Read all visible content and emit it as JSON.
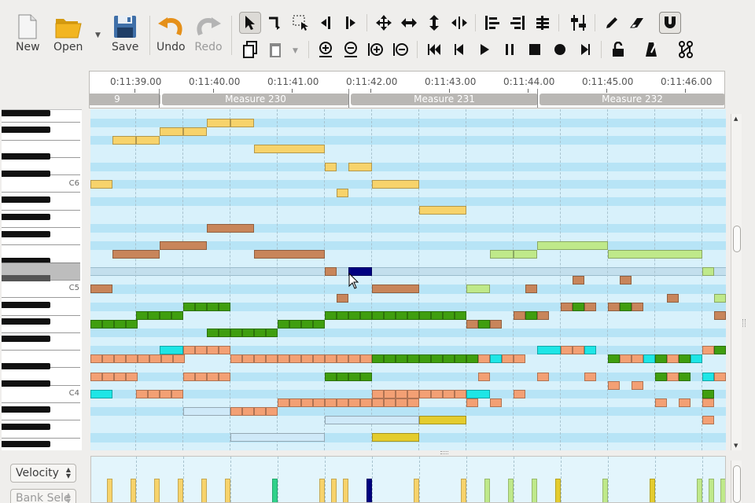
{
  "toolbar": {
    "new_label": "New",
    "open_label": "Open",
    "save_label": "Save",
    "undo_label": "Undo",
    "redo_label": "Redo"
  },
  "ruler": {
    "times": [
      "0:11:39.00",
      "0:11:40.00",
      "0:11:41.00",
      "0:11:42.00",
      "0:11:43.00",
      "0:11:44.00",
      "0:11:45.00",
      "0:11:46.00"
    ],
    "measures": [
      "9",
      "Measure 230",
      "Measure 231",
      "Measure 232"
    ]
  },
  "piano": {
    "octave_labels": [
      "C6",
      "C5",
      "C4"
    ]
  },
  "controller_panel": {
    "selected": "Velocity",
    "second": "Bank Sele"
  },
  "colors": {
    "background": "#efeeec",
    "grid": "#d8f1fb",
    "selected_note": "#000080"
  }
}
